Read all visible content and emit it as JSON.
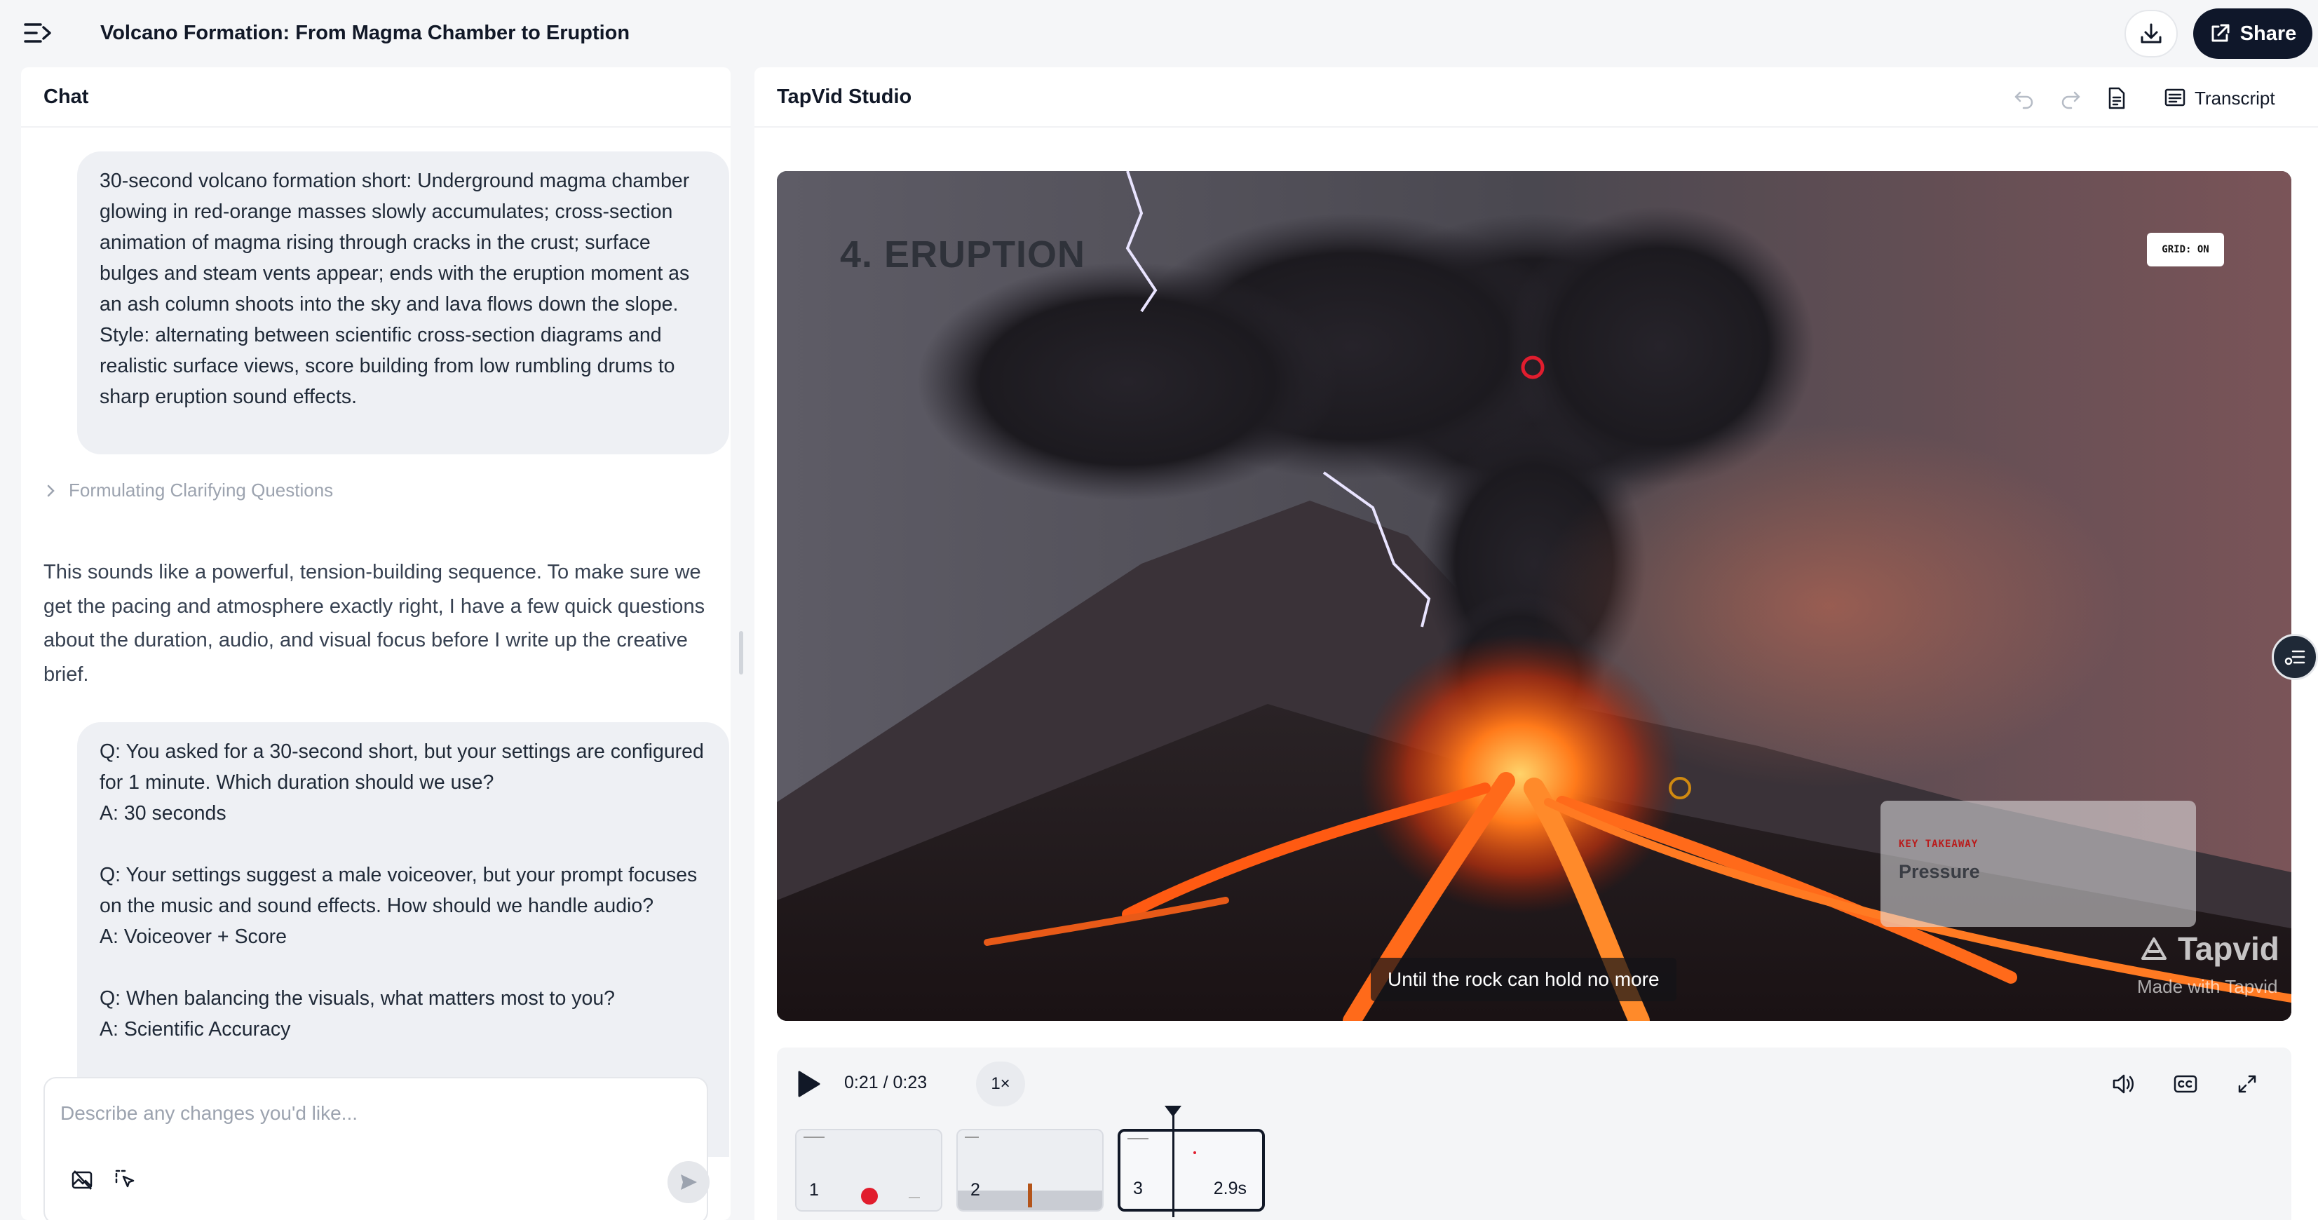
{
  "header": {
    "title": "Volcano Formation: From Magma Chamber to Eruption",
    "share_label": "Share",
    "menu_icon": "sidebar-toggle-icon",
    "download_icon": "download-icon"
  },
  "chat": {
    "title": "Chat",
    "user_prompt": "30-second volcano formation short: Underground magma chamber glowing in red-orange masses slowly accumulates; cross-section animation of magma rising through cracks in the crust; surface bulges and steam vents appear; ends with the eruption moment as an ash column shoots into the sky and lava flows down the slope. Style: alternating between scientific cross-section diagrams and realistic surface views, score building from low rumbling drums to sharp eruption sound effects.",
    "thinking_label": "Formulating Clarifying Questions",
    "assistant_reply": "This sounds like a powerful, tension-building sequence. To make sure we get the pacing and atmosphere exactly right, I have a few quick questions about the duration, audio, and visual focus before I write up the creative brief.",
    "qa": [
      {
        "q": "Q: You asked for a 30-second short, but your settings are configured for 1 minute. Which duration should we use?",
        "a": "A: 30 seconds"
      },
      {
        "q": "Q: Your settings suggest a male voiceover, but your prompt focuses on the music and sound effects. How should we handle audio?",
        "a": "A: Voiceover + Score"
      },
      {
        "q": "Q: When balancing the visuals, what matters most to you?",
        "a": "A: Scientific Accuracy"
      }
    ],
    "input_placeholder": "Describe any changes you'd like..."
  },
  "studio": {
    "title": "TapVid Studio",
    "transcript_label": "Transcript",
    "scene_title": "4. ERUPTION",
    "grid_badge": "GRID: ON",
    "takeaway_label": "KEY TAKEAWAY",
    "takeaway_value": "Pressure",
    "caption": "Until the rock can hold no more",
    "watermark_brand": "Tapvid",
    "watermark_sub": "Made with Tapvid",
    "time": "0:21 / 0:23",
    "speed": "1×",
    "clips": [
      {
        "number": "1",
        "duration": ""
      },
      {
        "number": "2",
        "duration": ""
      },
      {
        "number": "3",
        "duration": "2.9s"
      }
    ],
    "colors": {
      "lava": "#ff6a1a",
      "dark_ui": "#0f172a"
    }
  }
}
